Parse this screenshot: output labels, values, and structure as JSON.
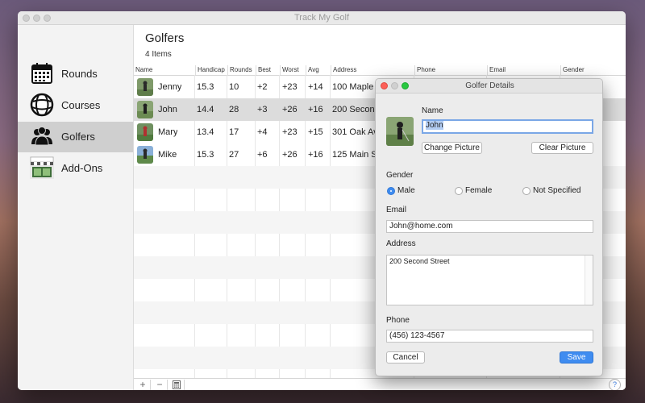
{
  "window": {
    "title": "Track My Golf"
  },
  "sidebar": {
    "items": [
      {
        "label": "Rounds",
        "icon": "calendar-icon"
      },
      {
        "label": "Courses",
        "icon": "globe-icon"
      },
      {
        "label": "Golfers",
        "icon": "people-icon",
        "selected": true
      },
      {
        "label": "Add-Ons",
        "icon": "store-icon"
      }
    ]
  },
  "main": {
    "title": "Golfers",
    "count": "4 Items",
    "columns": [
      "Name",
      "Handicap",
      "Rounds",
      "Best",
      "Worst",
      "Avg",
      "Address",
      "Phone",
      "Email",
      "Gender"
    ],
    "rows": [
      {
        "name": "Jenny",
        "handicap": "15.3",
        "rounds": "10",
        "best": "+2",
        "worst": "+23",
        "avg": "+14",
        "address": "100 Maple A"
      },
      {
        "name": "John",
        "handicap": "14.4",
        "rounds": "28",
        "best": "+3",
        "worst": "+26",
        "avg": "+16",
        "address": "200 Second"
      },
      {
        "name": "Mary",
        "handicap": "13.4",
        "rounds": "17",
        "best": "+4",
        "worst": "+23",
        "avg": "+15",
        "address": "301 Oak Av"
      },
      {
        "name": "Mike",
        "handicap": "15.3",
        "rounds": "27",
        "best": "+6",
        "worst": "+26",
        "avg": "+16",
        "address": "125 Main St"
      }
    ]
  },
  "bottom_bar": {
    "add": "+",
    "remove": "−",
    "help": "?"
  },
  "dialog": {
    "title": "Golfer Details",
    "name_label": "Name",
    "name_value": "John",
    "change_picture": "Change Picture",
    "clear_picture": "Clear Picture",
    "gender_label": "Gender",
    "gender_options": [
      "Male",
      "Female",
      "Not Specified"
    ],
    "gender_selected": "Male",
    "email_label": "Email",
    "email_value": "John@home.com",
    "address_label": "Address",
    "address_value": "200 Second Street",
    "phone_label": "Phone",
    "phone_value": "(456) 123-4567",
    "cancel": "Cancel",
    "save": "Save"
  },
  "colors": {
    "accent": "#3f8cf0",
    "close": "#fc5f57",
    "minimize": "#fdbc2e",
    "zoom": "#28c840"
  }
}
